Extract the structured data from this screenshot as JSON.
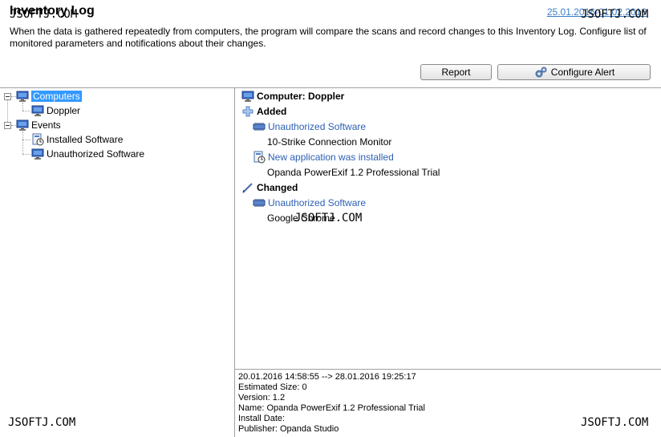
{
  "header": {
    "title": "Inventory Log",
    "date_range_link": "25.01.2016-01.02.2016",
    "description": "When the data is gathered repeatedly from computers, the program will compare the scans and record changes to this Inventory Log. Configure list of monitored parameters and notifications about their changes.",
    "report_button": "Report",
    "configure_alert_button": "Configure Alert"
  },
  "tree": {
    "computers_label": "Computers",
    "doppler_label": "Doppler",
    "events_label": "Events",
    "installed_software_label": "Installed Software",
    "unauthorized_software_label": "Unauthorized Software"
  },
  "log": {
    "computer_heading": "Computer: Doppler",
    "added_label": "Added",
    "added_item1_category": "Unauthorized Software",
    "added_item1_value": "10-Strike Connection Monitor",
    "added_item2_category": "New application was installed",
    "added_item2_value": "Opanda PowerExif 1.2 Professional Trial",
    "changed_label": "Changed",
    "changed_item1_category": "Unauthorized Software",
    "changed_item1_value": "Google Chrome"
  },
  "details": {
    "line_range": "20.01.2016 14:58:55 --> 28.01.2016 19:25:17",
    "estimated_size": "Estimated Size: 0",
    "version": "Version: 1.2",
    "name": "Name: Opanda PowerExif 1.2 Professional Trial",
    "install_date": "Install Date:",
    "publisher": "Publisher: Opanda Studio"
  },
  "watermarks": {
    "top_left": "JSOFTJ.COM",
    "top_right": "JSOFTJ.COM",
    "center": "JSOFTJ.COM",
    "bottom_left": "JSOFTJ.COM",
    "bottom_right": "JSOFTJ.COM"
  },
  "colors": {
    "link": "#2b5fb4",
    "selection": "#3399ff",
    "date_link": "#3a7ec6"
  }
}
